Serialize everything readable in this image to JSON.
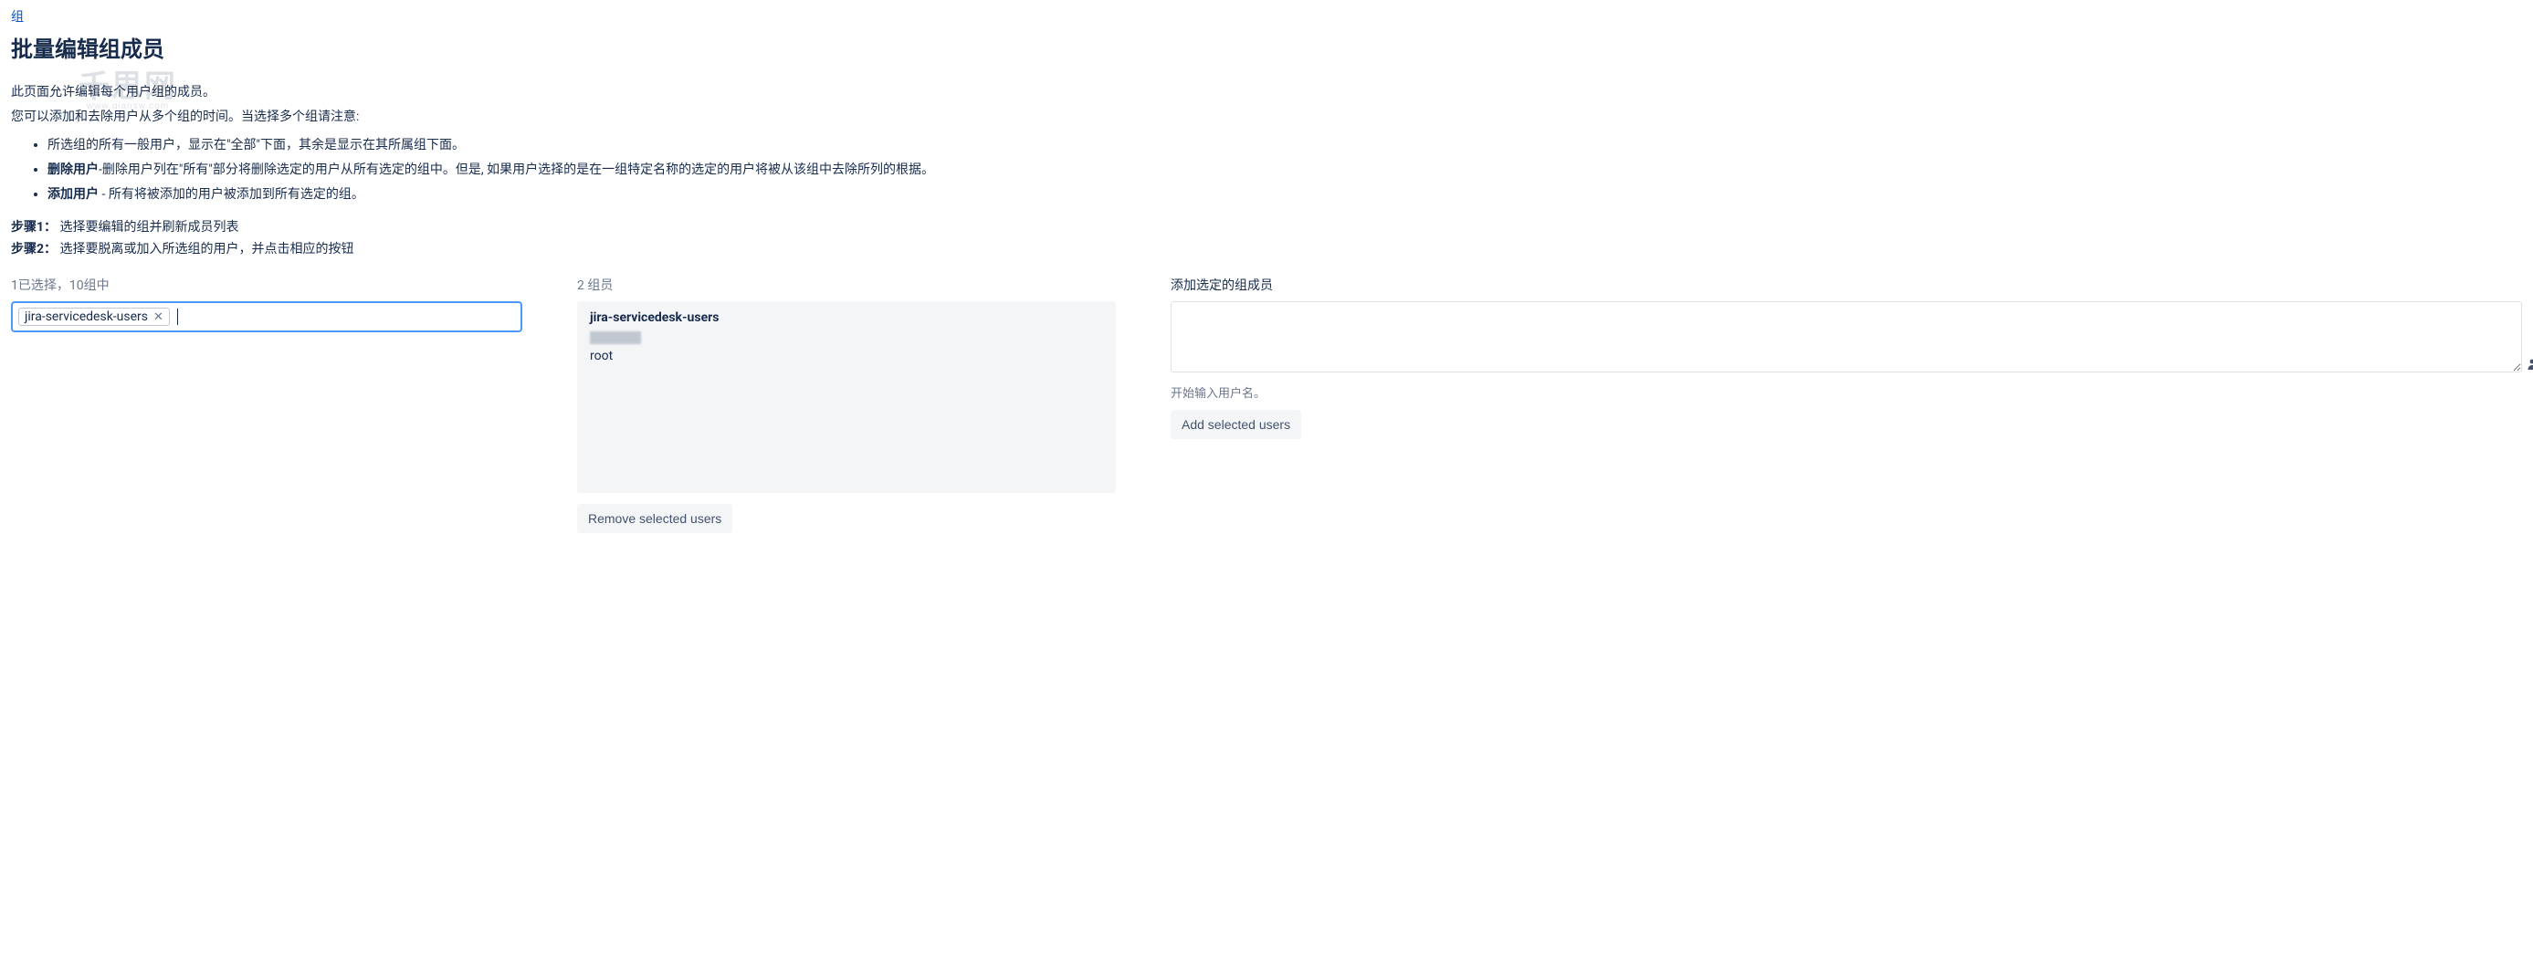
{
  "breadcrumb": {
    "group_link": "组"
  },
  "page_title": "批量编辑组成员",
  "intro": {
    "line1": "此页面允许编辑每个用户组的成员。",
    "line2": "您可以添加和去除用户从多个组的时间。当选择多个组请注意:",
    "bullet1": "所选组的所有一般用户，显示在\"全部\"下面，其余是显示在其所属组下面。",
    "bullet2_strong": "删除用户",
    "bullet2_rest": "-删除用户列在\"所有\"部分将删除选定的用户从所有选定的组中。但是, 如果用户选择的是在一组特定名称的选定的用户将被从该组中去除所列的根据。",
    "bullet3_strong": "添加用户",
    "bullet3_rest": " - 所有将被添加的用户被添加到所有选定的组。"
  },
  "steps": {
    "step1_label": "步骤1：",
    "step1_text": "选择要编辑的组并刷新成员列表",
    "step2_label": "步骤2：",
    "step2_text": "选择要脱离或加入所选组的用户，并点击相应的按钮"
  },
  "left": {
    "summary": "1已选择，10组中",
    "selected_chip": "jira-servicedesk-users"
  },
  "middle": {
    "summary": "2 组员",
    "group_title": "jira-servicedesk-users",
    "users": [
      "",
      "root"
    ],
    "remove_button": "Remove selected users"
  },
  "right": {
    "add_label": "添加选定的组成员",
    "hint": "开始输入用户名。",
    "add_button": "Add selected users"
  },
  "watermark": {
    "main": "千思网",
    "sub": "www.qiansw.com"
  }
}
